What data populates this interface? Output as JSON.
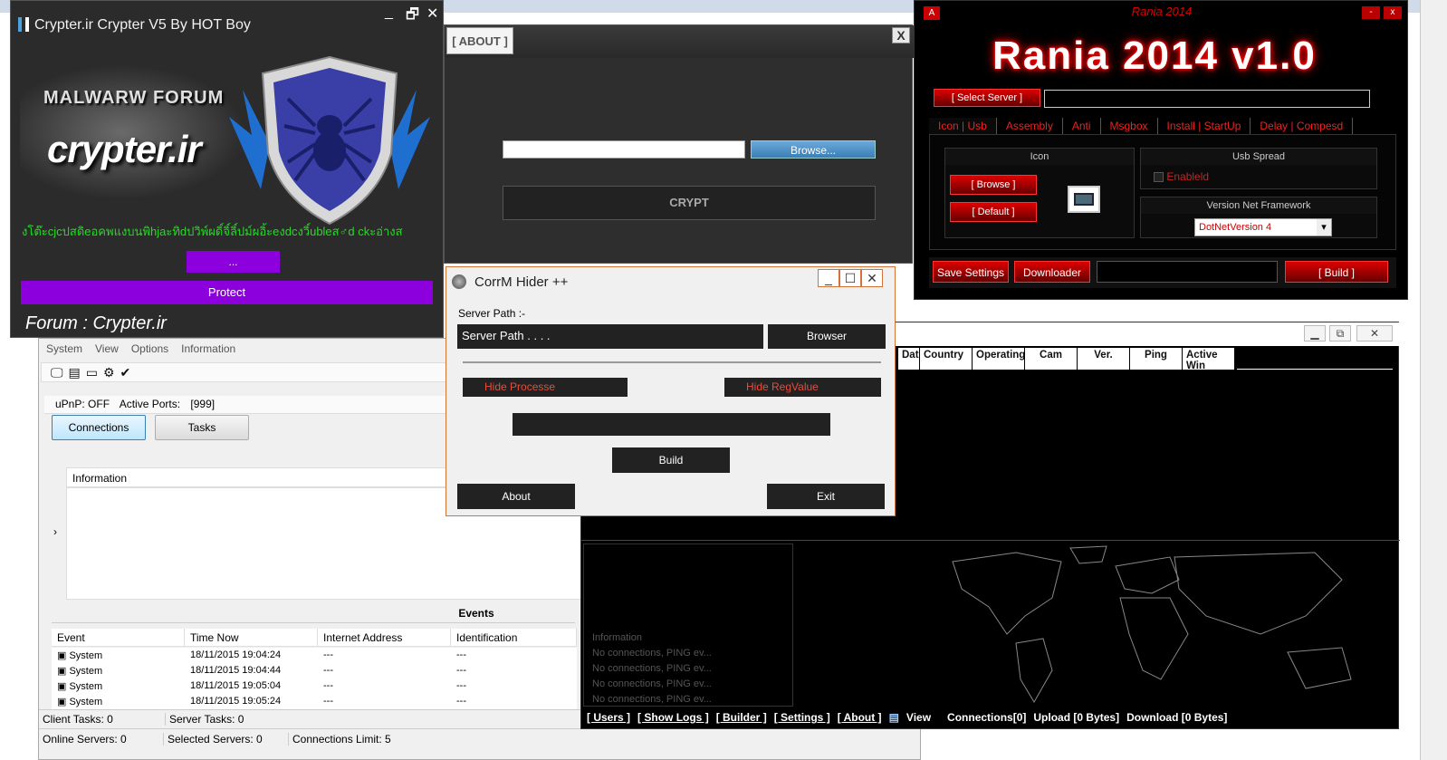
{
  "crypter": {
    "title": "Crypter.ir Crypter V5 By HOT Boy",
    "banner_forum": "MALWARW FORUM",
    "banner_brand": "crypter.ir",
    "thai_text": "งโต๊ะcjcปสดิeอคพแงบนพิhjaะทิdปวิพ์ผดิ์จิ์ลิ์ปม์ผอิ้ะeงdcงวิ์ubleส♂d ckะอ่างส",
    "dots_button": "...",
    "protect_button": "Protect",
    "footer": "Forum : Crypter.ir",
    "minimize": "_",
    "restore": "🗗",
    "close": "✕"
  },
  "about": {
    "tab": "[ ABOUT ]",
    "close": "X",
    "browse_button": "Browse...",
    "crypt_button": "CRYPT",
    "path_value": ""
  },
  "rania": {
    "title": "Rania 2014",
    "logo": "Rania 2014  v1.0",
    "a_button": "A",
    "minimize": "-",
    "close": "x",
    "select_server": "[ Select Server ]",
    "tabs": [
      "Icon | Usb",
      "Assembly",
      "Anti",
      "Msgbox",
      "Install | StartUp",
      "Delay  | Compesd"
    ],
    "icon_group": "Icon",
    "browse": "[ Browse ]",
    "default": "[ Default ]",
    "usb_group": "Usb Spread",
    "enabled": "Enableld",
    "net_group": "Version Net Framework",
    "net_value": "DotNetVersion 4",
    "save_settings": "Save Settings",
    "downloader": "Downloader",
    "build": "[ Build ]"
  },
  "corrm": {
    "title": "CorrM Hider ++",
    "server_path_label": "Server Path :-",
    "server_path_value": "Server Path . . . .",
    "browser": "Browser",
    "hide_process": "Hide Processe",
    "hide_regvalue": "Hide RegValue",
    "build": "Build",
    "about": "About",
    "exit": "Exit"
  },
  "rat": {
    "menu": [
      "System",
      "View",
      "Options",
      "Information"
    ],
    "upnp": "uPnP: OFF",
    "active_ports_label": "Active Ports:",
    "active_ports_value": "[999]",
    "connections_tab": "Connections",
    "tasks_tab": "Tasks",
    "info_header": "Information",
    "events_title": "Events",
    "event_columns": [
      "Event",
      "Time Now",
      "Internet Address",
      "Identification"
    ],
    "events": [
      {
        "event": "System",
        "time": "18/11/2015 19:04:24",
        "addr": "---",
        "id": "---"
      },
      {
        "event": "System",
        "time": "18/11/2015 19:04:44",
        "addr": "---",
        "id": "---"
      },
      {
        "event": "System",
        "time": "18/11/2015 19:05:04",
        "addr": "---",
        "id": "---"
      },
      {
        "event": "System",
        "time": "18/11/2015 19:05:24",
        "addr": "---",
        "id": "---"
      }
    ],
    "client_tasks": "Client Tasks: 0",
    "server_tasks": "Server Tasks: 0",
    "online_servers": "Online Servers: 0",
    "selected_servers": "Selected Servers: 0",
    "connections_limit": "Connections Limit: 5"
  },
  "dark": {
    "columns": [
      "Dat",
      "Country",
      "Operating",
      "Cam",
      "Ver.",
      "Ping",
      "Active Win"
    ],
    "info_label": "Information",
    "info_lines": [
      "No connections, PING ev...",
      "No connections, PING ev...",
      "No connections, PING ev...",
      "No connections, PING ev..."
    ],
    "links": [
      "[ Users ]",
      "[ Show Logs ]",
      "[ Builder ]",
      "[ Settings ]",
      "[ About ]"
    ],
    "view": "View",
    "connections": "Connections[0]",
    "upload": "Upload [0 Bytes]",
    "download": "Download [0 Bytes]"
  }
}
